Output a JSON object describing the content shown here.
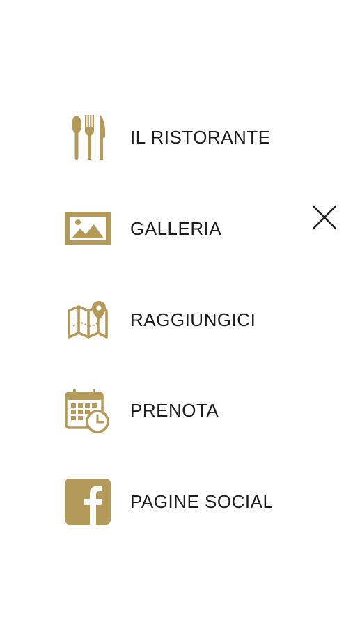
{
  "menu": {
    "items": [
      {
        "label": "IL RISTORANTE",
        "icon": "cutlery-icon"
      },
      {
        "label": "GALLERIA",
        "icon": "picture-icon"
      },
      {
        "label": "RAGGIUNGICI",
        "icon": "map-pin-icon"
      },
      {
        "label": "PRENOTA",
        "icon": "calendar-clock-icon"
      },
      {
        "label": "PAGINE SOCIAL",
        "icon": "facebook-icon"
      }
    ]
  },
  "close": {
    "icon": "close-icon"
  },
  "colors": {
    "accent": "#b49a5a",
    "text": "#1c1c1c",
    "background": "#ffffff"
  }
}
